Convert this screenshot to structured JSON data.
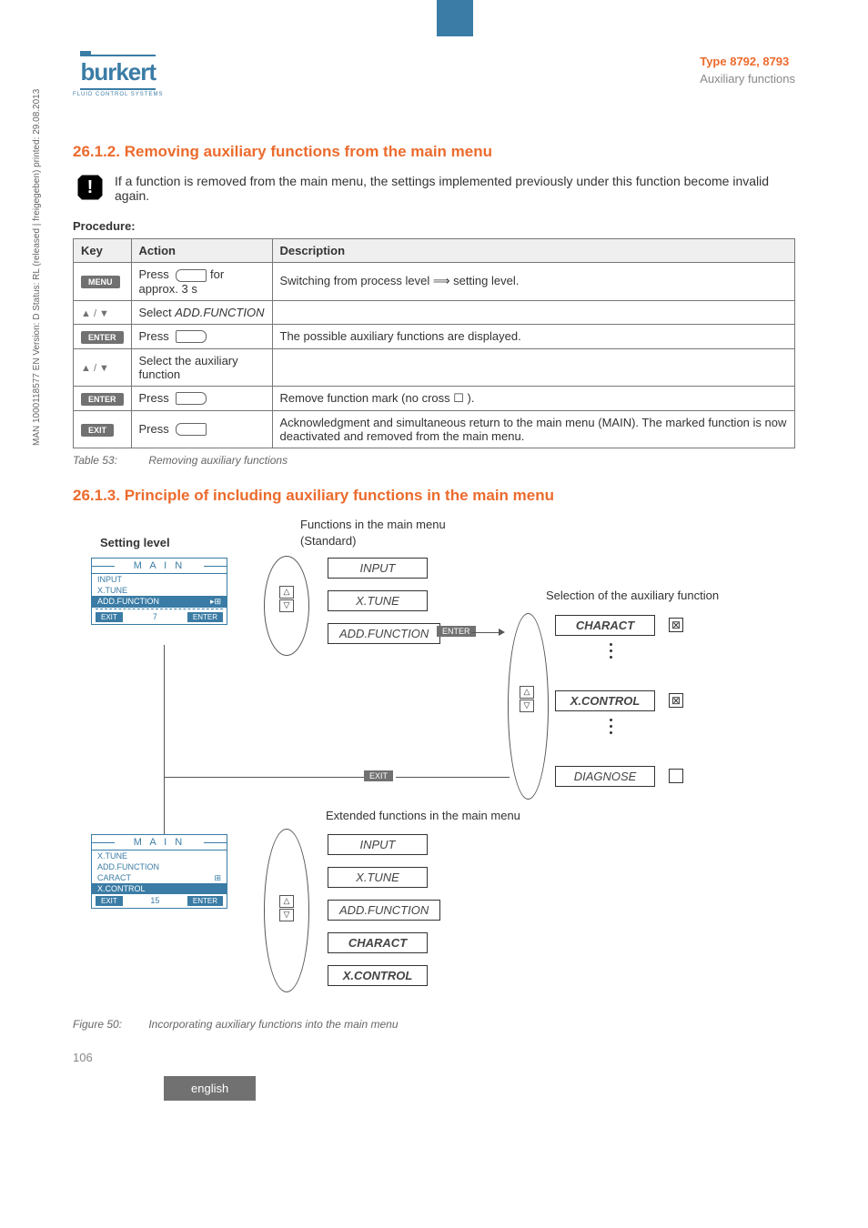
{
  "header": {
    "typeLine": "Type 8792, 8793",
    "subLine": "Auxiliary functions",
    "logoName": "burkert",
    "logoSub": "FLUID CONTROL SYSTEMS"
  },
  "sideText": "MAN 1000118577 EN Version: D Status: RL (released | freigegeben) printed: 29.08.2013",
  "s1": {
    "title": "26.1.2.  Removing auxiliary functions from the main menu"
  },
  "note": "If a function is removed from the main menu, the settings implemented previously under this function become invalid again.",
  "procLabel": "Procedure:",
  "th": {
    "key": "Key",
    "action": "Action",
    "desc": "Description"
  },
  "keys": {
    "menu": "MENU",
    "enter": "ENTER",
    "exit": "EXIT"
  },
  "rows": {
    "r1a": "Press ",
    "r1b": " for approx. 3 s",
    "r1d": "Switching from process level ⟹ setting level.",
    "r2a": "Select ADD.FUNCTION",
    "r3a": "Press ",
    "r3d": "The possible auxiliary functions are displayed.",
    "r4a": "Select the auxiliary function",
    "r5a": "Press ",
    "r5d": "Remove function mark (no cross ☐ ).",
    "r6a": "Press ",
    "r6d": "Acknowledgment and simultaneous return to the main menu (MAIN). The marked function is now deactivated and removed from the main menu."
  },
  "cap1": {
    "label": "Table 53:",
    "text": "Removing auxiliary functions"
  },
  "s2": {
    "title": "26.1.3.  Principle of including auxiliary functions in the main menu"
  },
  "diag": {
    "settingLevel": "Setting level",
    "funcsStd1": "Functions in the main menu",
    "funcsStd2": "(Standard)",
    "selAux": "Selection of the auxiliary function",
    "extFunc": "Extended functions in the main menu",
    "panel1": {
      "title": "M A I N",
      "items": [
        "INPUT",
        "X.TUNE"
      ],
      "selected": "ADD.FUNCTION",
      "footerMid": "7"
    },
    "panel2": {
      "title": "M A I N",
      "items": [
        "X.TUNE",
        "ADD.FUNCTION",
        "CARACT"
      ],
      "selected": "X.CONTROL",
      "footerMid": "15"
    },
    "stdFuncs": [
      "INPUT",
      "X.TUNE",
      "ADD.FUNCTION"
    ],
    "auxFuncs": [
      "CHARACT",
      "X.CONTROL",
      "DIAGNOSE"
    ],
    "extFuncs": [
      "INPUT",
      "X.TUNE",
      "ADD.FUNCTION",
      "CHARACT",
      "X.CONTROL"
    ],
    "enter": "ENTER",
    "exit": "EXIT"
  },
  "cap2": {
    "label": "Figure 50:",
    "text": "Incorporating auxiliary functions into the main menu"
  },
  "pageNum": "106",
  "lang": "english"
}
